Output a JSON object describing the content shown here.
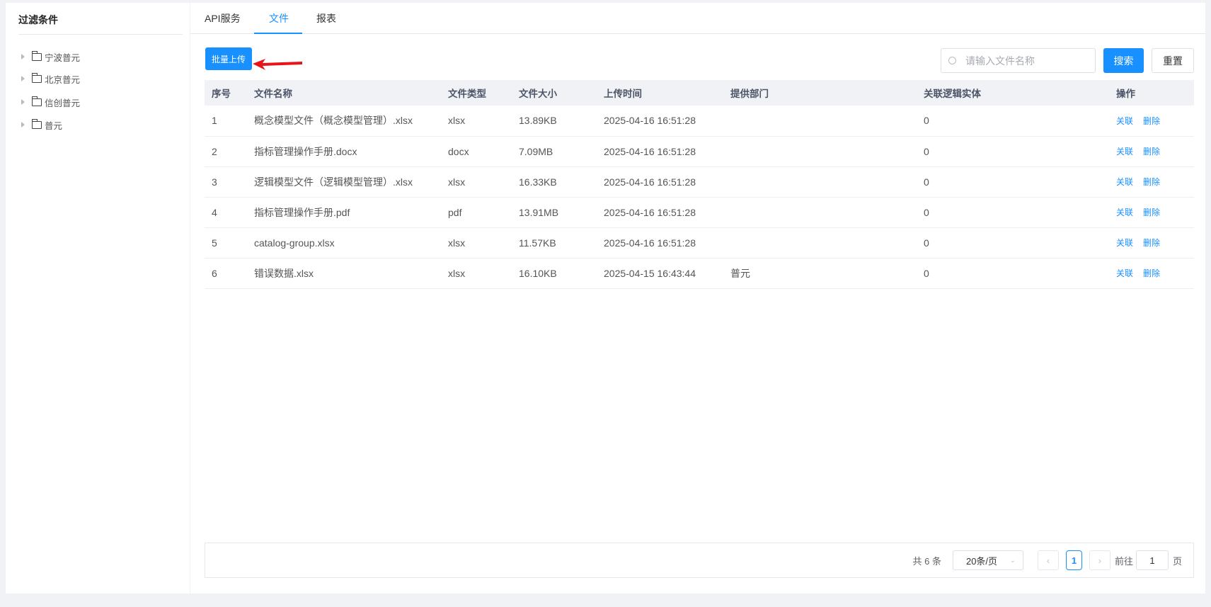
{
  "sidebar": {
    "title": "过滤条件",
    "items": [
      {
        "label": "宁波普元"
      },
      {
        "label": "北京普元"
      },
      {
        "label": "信创普元"
      },
      {
        "label": "普元"
      }
    ]
  },
  "tabs": [
    {
      "label": "API服务"
    },
    {
      "label": "文件"
    },
    {
      "label": "报表"
    }
  ],
  "active_tab": "文件",
  "toolbar": {
    "upload": "批量上传",
    "search_placeholder": "请输入文件名称",
    "search": "搜索",
    "reset": "重置"
  },
  "table": {
    "headers": [
      "序号",
      "文件名称",
      "文件类型",
      "文件大小",
      "上传时间",
      "提供部门",
      "关联逻辑实体",
      "操作"
    ],
    "rows": [
      [
        "1",
        "概念模型文件（概念模型管理）.xlsx",
        "xlsx",
        "13.89KB",
        "2025-04-16 16:51:28",
        "",
        "0"
      ],
      [
        "2",
        "指标管理操作手册.docx",
        "docx",
        "7.09MB",
        "2025-04-16 16:51:28",
        "",
        "0"
      ],
      [
        "3",
        "逻辑模型文件（逻辑模型管理）.xlsx",
        "xlsx",
        "16.33KB",
        "2025-04-16 16:51:28",
        "",
        "0"
      ],
      [
        "4",
        "指标管理操作手册.pdf",
        "pdf",
        "13.91MB",
        "2025-04-16 16:51:28",
        "",
        "0"
      ],
      [
        "5",
        "catalog-group.xlsx",
        "xlsx",
        "11.57KB",
        "2025-04-16 16:51:28",
        "",
        "0"
      ],
      [
        "6",
        "错误数据.xlsx",
        "xlsx",
        "16.10KB",
        "2025-04-15 16:43:44",
        "普元",
        "0"
      ]
    ],
    "actions": [
      "关联",
      "删除"
    ]
  },
  "pagination": {
    "total": "共 6 条",
    "page_size": "20条/页",
    "current": "1",
    "goto_label": "前往",
    "goto_value": "1",
    "page_suffix": "页"
  },
  "colors": {
    "accent": "#1890ff",
    "background": "#f0f2f5"
  }
}
